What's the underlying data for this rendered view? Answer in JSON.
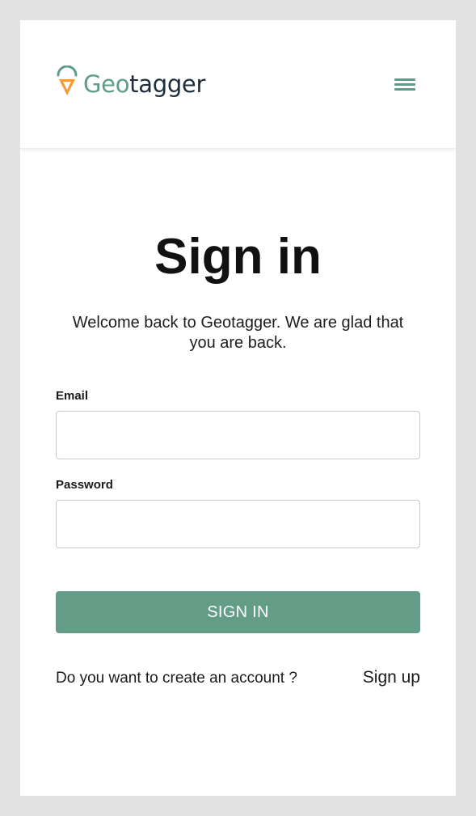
{
  "header": {
    "logo_geo": "Geo",
    "logo_tagger": "tagger",
    "menu_icon": "hamburger-menu-icon"
  },
  "main": {
    "title": "Sign in",
    "subtitle": "Welcome back to Geotagger. We are glad that you are back.",
    "email": {
      "label": "Email",
      "value": "",
      "placeholder": ""
    },
    "password": {
      "label": "Password",
      "value": "",
      "placeholder": ""
    },
    "signin_button": "SIGN IN",
    "create_account_text": "Do you want to create an account ?",
    "signup_link": "Sign up"
  },
  "colors": {
    "brand_green": "#639d87",
    "logo_orange": "#f39a3a",
    "text_dark": "#1a1a1a",
    "background": "#e2e2e2"
  }
}
